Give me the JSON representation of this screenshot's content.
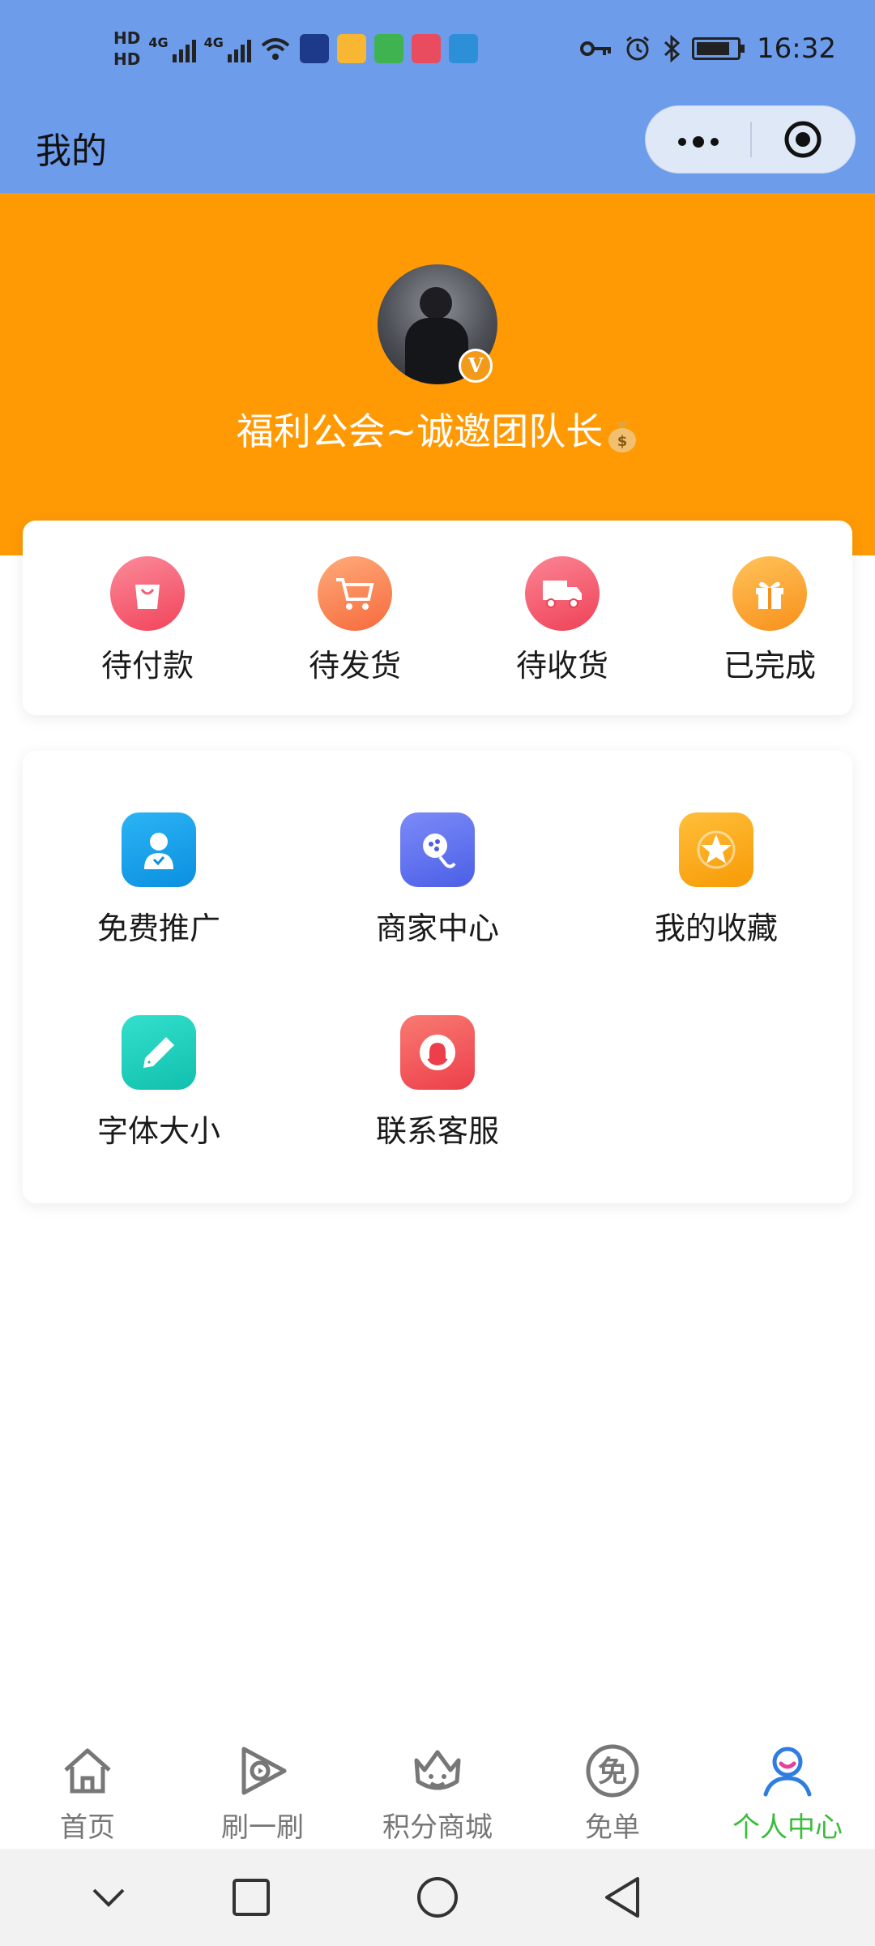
{
  "status_bar": {
    "time": "16:32",
    "hd1": "HD",
    "hd2": "HD",
    "net1": "4G",
    "net2": "4G"
  },
  "navbar": {
    "title": "我的",
    "more_icon": "more-dots-icon",
    "close_icon": "target-circle-icon"
  },
  "profile": {
    "username": "福利公会~诚邀团队长",
    "badge": "V",
    "bg_color": "#ff9a04"
  },
  "orders": [
    {
      "label": "待付款",
      "icon": "shopping-bag-icon",
      "color": "#f45b6e"
    },
    {
      "label": "待发货",
      "icon": "cart-icon",
      "color": "#fb7b50"
    },
    {
      "label": "待收货",
      "icon": "truck-icon",
      "color": "#f2566a"
    },
    {
      "label": "已完成",
      "icon": "gift-icon",
      "color": "#fca22b"
    }
  ],
  "menu": [
    {
      "label": "免费推广",
      "icon": "user-promote-icon",
      "color": "#169ee8"
    },
    {
      "label": "商家中心",
      "icon": "merchant-icon",
      "color": "#5a6ef0"
    },
    {
      "label": "我的收藏",
      "icon": "star-icon",
      "color": "#fba412"
    },
    {
      "label": "字体大小",
      "icon": "pencil-icon",
      "color": "#1cc9b9"
    },
    {
      "label": "联系客服",
      "icon": "headset-icon",
      "color": "#f1535b"
    }
  ],
  "tabs": [
    {
      "label": "首页",
      "icon": "home-icon"
    },
    {
      "label": "刷一刷",
      "icon": "play-icon"
    },
    {
      "label": "积分商城",
      "icon": "crown-icon"
    },
    {
      "label": "免单",
      "icon": "free-badge-icon",
      "icon_text": "免"
    },
    {
      "label": "个人中心",
      "icon": "person-icon",
      "active": true
    }
  ],
  "colors": {
    "header_blue": "#6d9ceb",
    "active_tab": "#3dbb3d"
  }
}
